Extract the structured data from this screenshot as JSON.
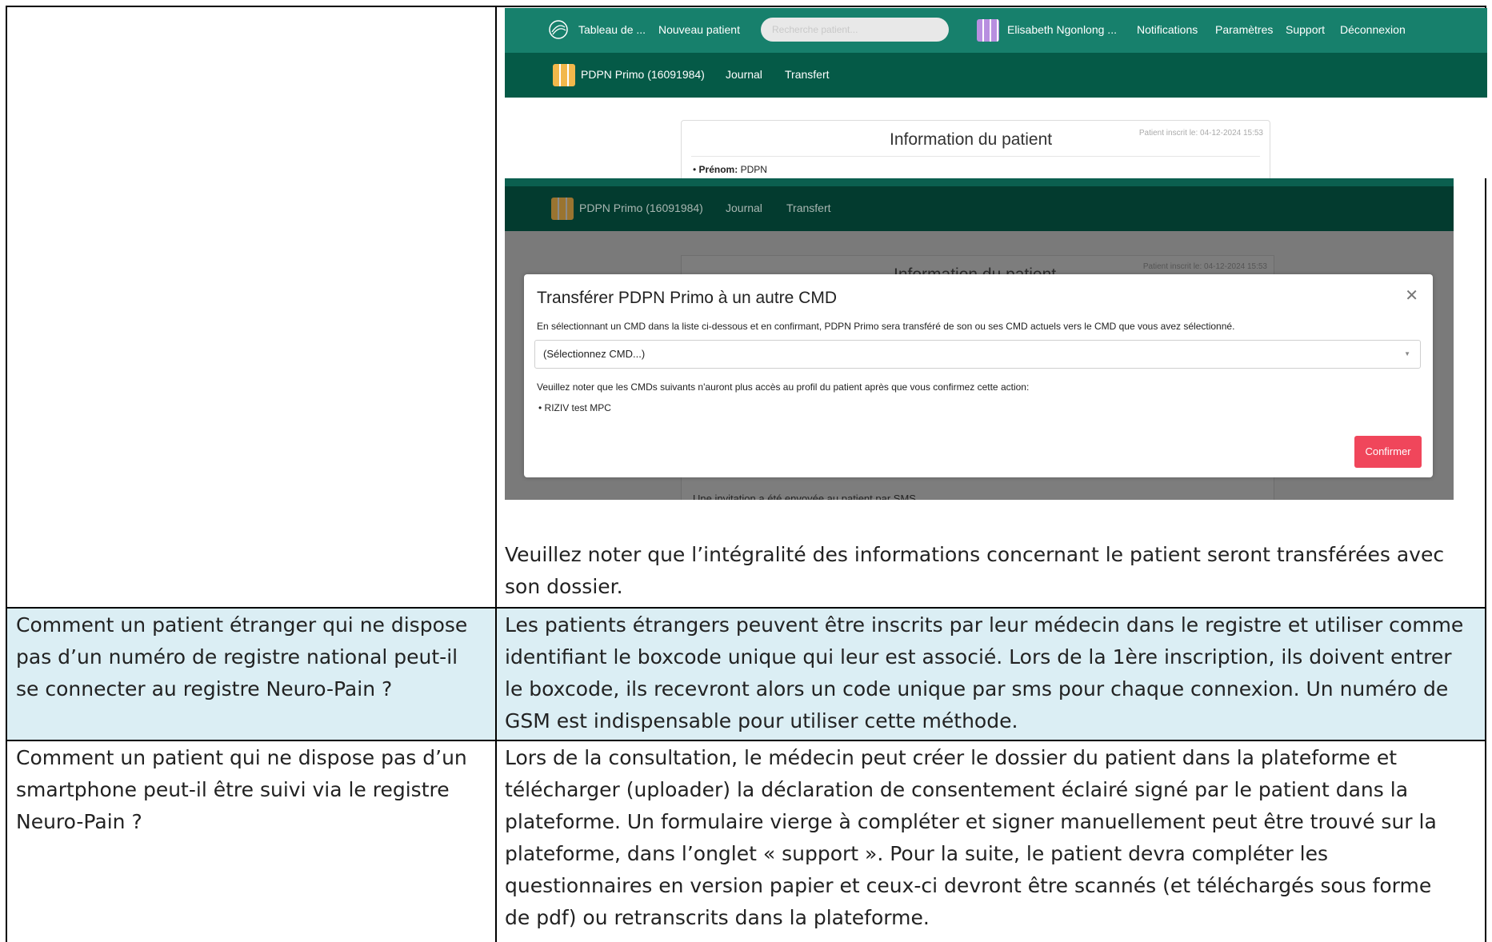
{
  "screenshot1": {
    "nav": {
      "dashboard": "Tableau de ...",
      "new_patient": "Nouveau patient",
      "search_placeholder": "Recherche patient...",
      "user": "Elisabeth Ngonlong ...",
      "notifications": "Notifications",
      "settings": "Paramètres",
      "support": "Support",
      "logout": "Déconnexion"
    },
    "subnav": {
      "patient": "PDPN Primo (16091984)",
      "journal": "Journal",
      "transfer": "Transfert"
    },
    "card": {
      "title": "Information du patient",
      "registered": "Patient inscrit le: 04-12-2024 15:53",
      "firstname_label": "Prénom:",
      "firstname_value": "PDPN"
    }
  },
  "screenshot2": {
    "subnav": {
      "patient": "PDPN Primo (16091984)",
      "journal": "Journal",
      "transfer": "Transfert"
    },
    "card_title": "Information du patient",
    "registered": "Patient inscrit le: 04-12-2024 15:53",
    "modal": {
      "title": "Transférer PDPN Primo à un autre CMD",
      "description": "En sélectionnant un CMD dans la liste ci-dessous et en confirmant, PDPN Primo sera transféré de son ou ses CMD actuels vers le CMD que vous avez sélectionné.",
      "select_value": "(Sélectionnez CMD...)",
      "note": "Veuillez noter que les CMDs suivants n'auront plus accès au profil du patient après que vous confirmez cette action:",
      "cmd_list": [
        "RIZIV test MPC"
      ],
      "confirm": "Confirmer"
    },
    "sms_notice": "Une invitation a été envoyée au patient par SMS."
  },
  "first_row_note": [
    "Veuillez noter que l’intégralité des informations concernant le patient seront transférées avec",
    "son dossier."
  ],
  "faq": [
    {
      "question": [
        "Comment un patient étranger qui ne dispose",
        "pas d’un numéro de registre national peut-il",
        "se connecter au registre Neuro-Pain ?"
      ],
      "answer": [
        "Les patients étrangers peuvent être inscrits par leur médecin dans le registre et utiliser comme",
        "identifiant le boxcode unique qui leur est associé. Lors de la 1ère inscription, ils doivent entrer",
        "le boxcode, ils recevront alors un code unique par sms pour chaque connexion. Un numéro de",
        "GSM est indispensable pour utiliser cette méthode."
      ]
    },
    {
      "question": [
        "Comment un patient qui ne dispose pas d’un",
        "smartphone peut-il être suivi via le registre",
        "Neuro-Pain ?"
      ],
      "answer": [
        "Lors de la consultation, le médecin peut créer le dossier du patient dans la plateforme et",
        "télécharger (uploader) la déclaration de consentement éclairé signé par le patient dans la",
        "plateforme. Un formulaire vierge à compléter et signer manuellement peut être trouvé sur la",
        "plateforme, dans l’onglet « support ».  Pour la suite, le patient devra compléter les",
        "questionnaires en version papier et ceux-ci devront être scannés (et téléchargés sous forme",
        "de pdf) ou retranscrits dans la plateforme."
      ]
    }
  ],
  "colors": {
    "nav_green": "#17806c",
    "subnav_green": "#055a47",
    "row_highlight": "#dbeef4",
    "confirm_red": "#f0465b"
  }
}
